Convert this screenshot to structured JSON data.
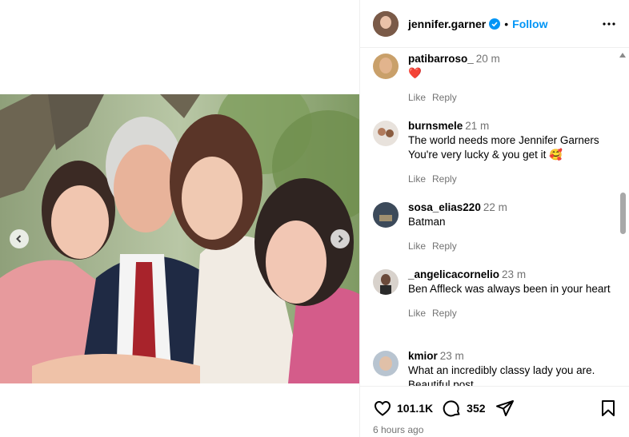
{
  "post": {
    "username": "jennifer.garner",
    "separator": "•",
    "follow_label": "Follow",
    "likes": "101.1K",
    "comments_count": "352",
    "posted": "6 hours ago"
  },
  "comments": [
    {
      "user": "patibarroso_",
      "time": "20 m",
      "text": "❤️",
      "like": "Like",
      "reply": "Reply"
    },
    {
      "user": "burnsmele",
      "time": "21 m",
      "text": "The world needs more Jennifer Garners You're very lucky & you get it 🥰",
      "like": "Like",
      "reply": "Reply"
    },
    {
      "user": "sosa_elias220",
      "time": "22 m",
      "text": "Batman",
      "like": "Like",
      "reply": "Reply"
    },
    {
      "user": "_angelicacornelio",
      "time": "23 m",
      "text": "Ben Affleck was always been in your heart",
      "like": "Like",
      "reply": "Reply"
    },
    {
      "user": "kmior",
      "time": "23 m",
      "text": "What an incredibly classy lady you are. Beautiful post",
      "like": "",
      "reply": ""
    }
  ],
  "icons": [
    "verified-badge-icon",
    "more-options-icon",
    "heart-icon",
    "comment-icon",
    "share-icon",
    "bookmark-icon",
    "chevron-left-icon",
    "chevron-right-icon"
  ],
  "colors": {
    "accent": "#0095f6",
    "muted": "#737373",
    "heart_red": "#ff3040"
  }
}
